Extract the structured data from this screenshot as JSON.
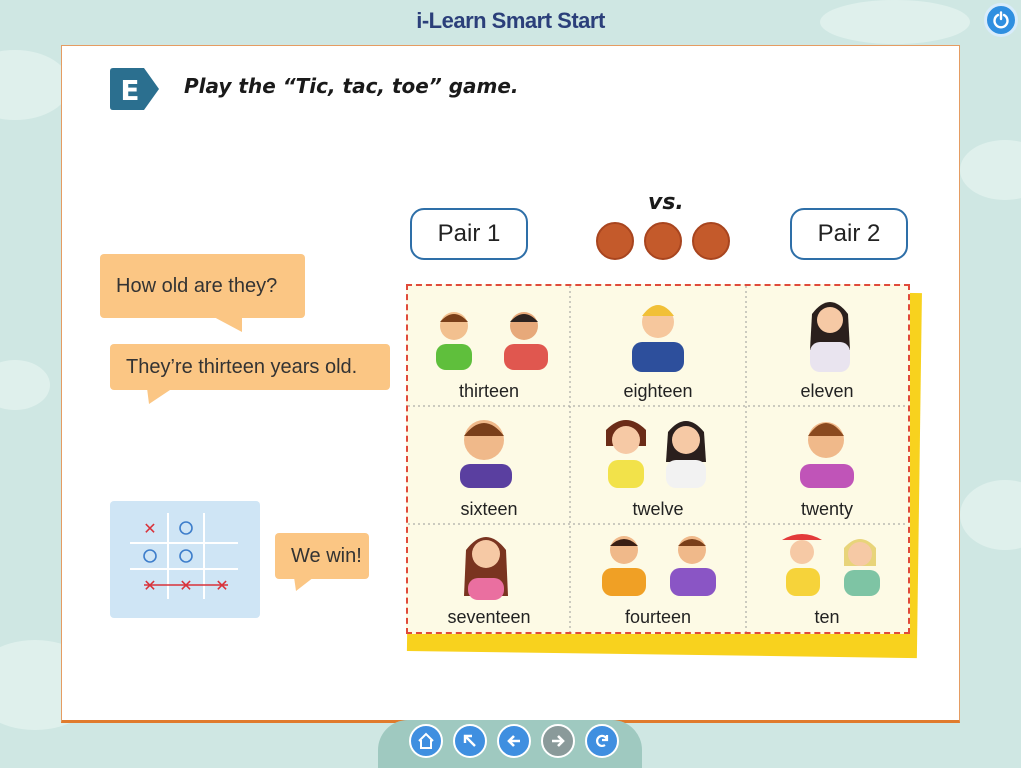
{
  "app": {
    "title": "i-Learn Smart Start"
  },
  "exercise": {
    "letter": "E",
    "instruction": "Play the “Tic, tac, toe” game."
  },
  "game": {
    "vs_label": "vs.",
    "pair1": "Pair 1",
    "pair2": "Pair 2"
  },
  "dialogue": {
    "question": "How old are they?",
    "answer": "They’re thirteen years old.",
    "win": "We win!"
  },
  "board": {
    "cells": [
      "thirteen",
      "eighteen",
      "eleven",
      "sixteen",
      "twelve",
      "twenty",
      "seventeen",
      "fourteen",
      "ten"
    ]
  },
  "mini_grid": {
    "cells": [
      "x",
      "o",
      "",
      "o",
      "o",
      "",
      "x",
      "x",
      "x"
    ]
  },
  "nav": {
    "buttons": [
      "home-icon",
      "collapse-icon",
      "back-icon",
      "forward-icon",
      "reload-icon"
    ]
  },
  "colors": {
    "accent": "#e07b2d",
    "bubble": "#fbc684",
    "board_border": "#e04a3a",
    "nav_blue": "#3f8fe0"
  }
}
